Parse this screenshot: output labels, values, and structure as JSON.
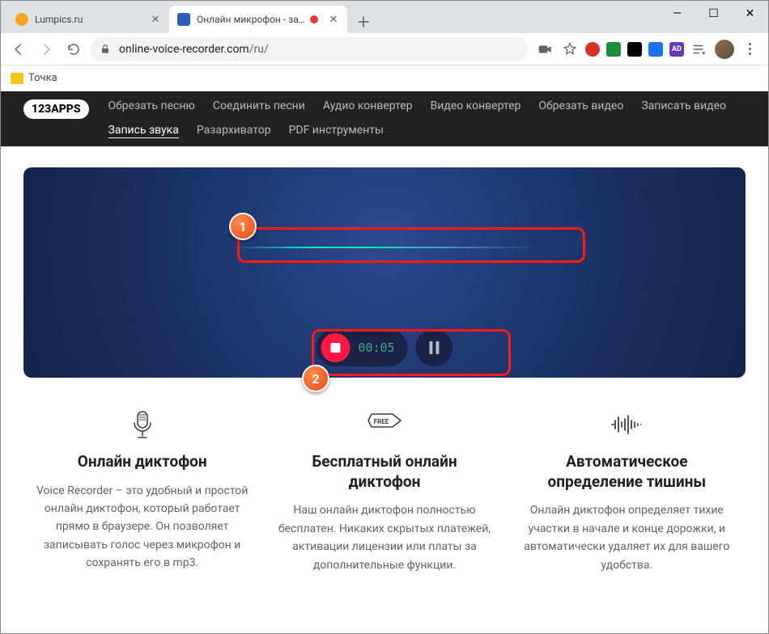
{
  "tabs": [
    {
      "title": "Lumpics.ru"
    },
    {
      "title": "Онлайн микрофон - запись"
    }
  ],
  "address": {
    "host": "online-voice-recorder.com",
    "path": "/ru/"
  },
  "bookmark": {
    "label": "Точка"
  },
  "siteNav": {
    "logo": "123APPS",
    "links": [
      "Обрезать песню",
      "Соединить песни",
      "Аудио конвертер",
      "Видео конвертер",
      "Обрезать видео",
      "Записать видео",
      "Запись звука",
      "Разархиватор",
      "PDF инструменты"
    ],
    "activeIndex": 6
  },
  "recorder": {
    "timer": "00:05"
  },
  "callouts": {
    "one": "1",
    "two": "2"
  },
  "ext": {
    "ad": "AD"
  },
  "features": [
    {
      "title": "Онлайн диктофон",
      "body": "Voice Recorder – это удобный и простой онлайн диктофон, который работает прямо в браузере. Он позволяет записывать голос через микрофон и сохранять его в mp3."
    },
    {
      "title": "Бесплатный онлайн диктофон",
      "body": "Наш онлайн диктофон полностью бесплатен. Никаких скрытых платежей, активации лицензии или платы за дополнительные функции."
    },
    {
      "title": "Автоматическое определение тишины",
      "body": "Онлайн диктофон определяет тихие участки в начале и конце дорожки, и автоматически удаляет их для вашего удобства."
    }
  ]
}
